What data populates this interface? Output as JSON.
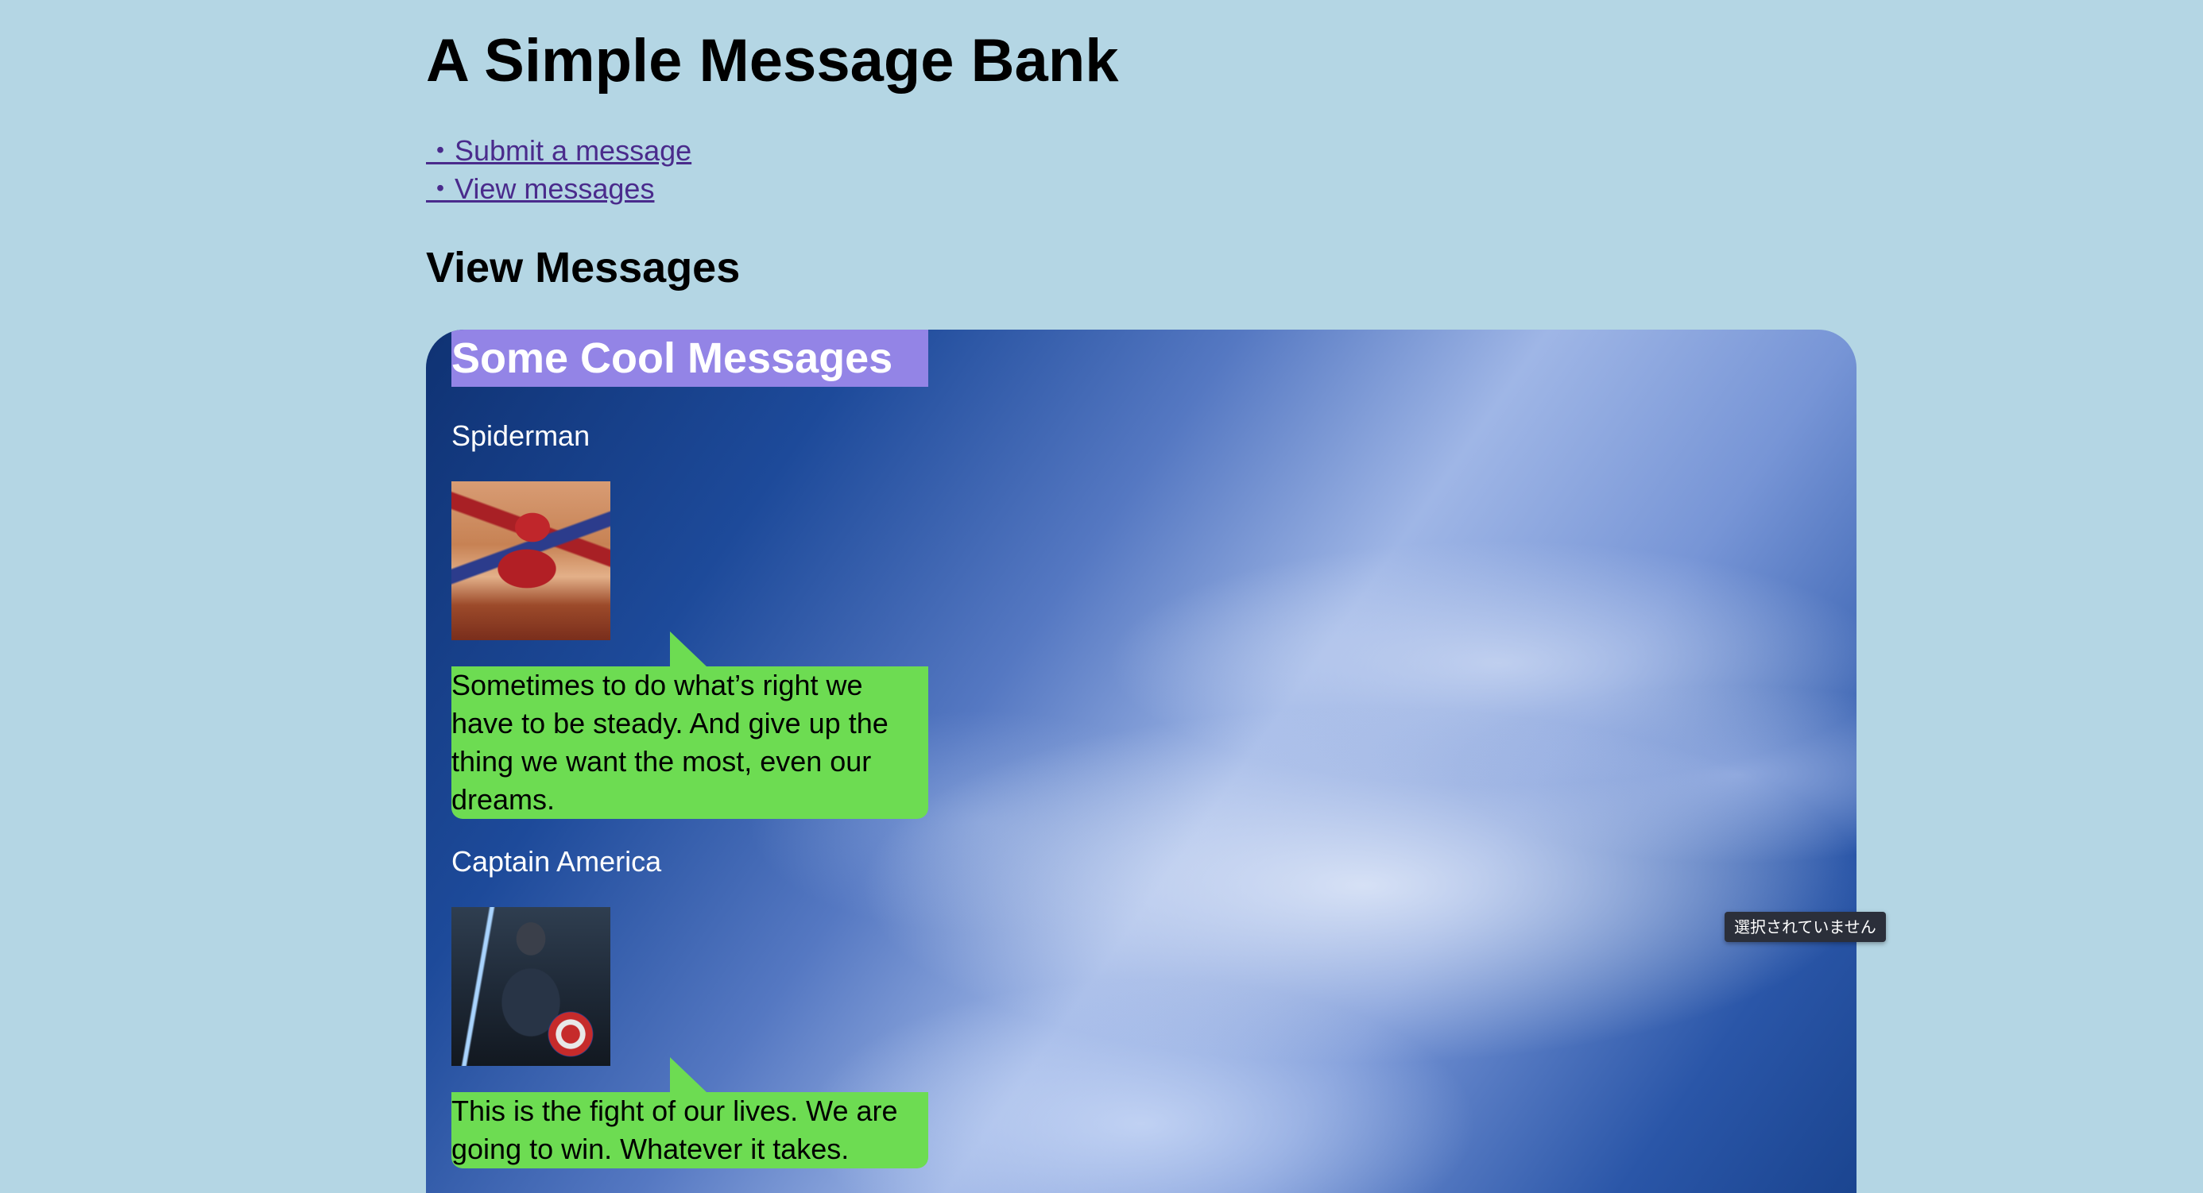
{
  "header": {
    "title": "A Simple Message Bank"
  },
  "nav": {
    "submit_link": "・Submit a message",
    "view_link": "・View messages"
  },
  "section": {
    "title": "View Messages"
  },
  "panel": {
    "title": "Some Cool Messages",
    "messages": [
      {
        "author": "Spiderman",
        "text": "Sometimes to do what’s right we have to be steady. And give up the thing we want the most, even our dreams."
      },
      {
        "author": "Captain America",
        "text": "This is the fight of our lives. We are going to win. Whatever it takes."
      }
    ]
  },
  "tooltip": {
    "text": "選択されていません"
  }
}
